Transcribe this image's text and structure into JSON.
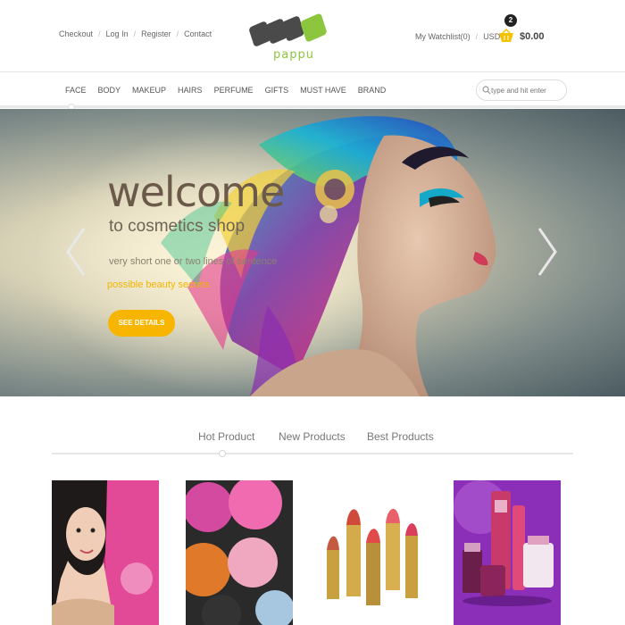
{
  "header": {
    "links": [
      "Checkout",
      "Log In",
      "Register",
      "Contact"
    ],
    "brand": "pappu",
    "watchlist": "My Watchlist(0)",
    "currency": "USD",
    "cart_count": "2",
    "cart_total": "$0.00"
  },
  "nav": {
    "items": [
      "FACE",
      "BODY",
      "MAKEUP",
      "HAIRS",
      "PERFUME",
      "GIFTS",
      "MUST HAVE",
      "BRAND"
    ],
    "search_placeholder": "type and hit enter"
  },
  "hero": {
    "title": "welcome",
    "subtitle": "to cosmetics shop",
    "line": "very short one or two lines of sentence",
    "highlight": "possible beauty secrets",
    "cta": "SEE DETAILS"
  },
  "product_tabs": [
    "Hot Product",
    "New Products",
    "Best Products"
  ],
  "colors": {
    "accent": "#f7b500",
    "brand_green": "#8cc63f",
    "logo_dark": "#4a4a4a"
  },
  "icons": {
    "cart": "basket-icon",
    "search": "search-icon",
    "prev": "chevron-left-icon",
    "next": "chevron-right-icon"
  }
}
